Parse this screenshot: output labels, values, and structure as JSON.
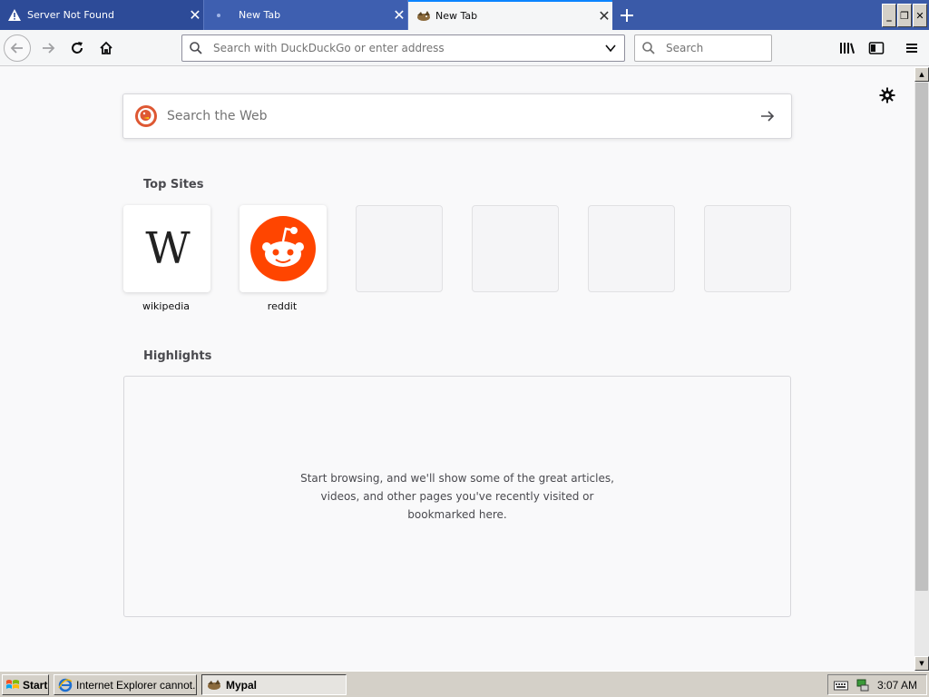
{
  "tabs": [
    {
      "title": "Server Not Found",
      "icon": "warning-icon"
    },
    {
      "title": "New Tab",
      "icon": "loading-dot-icon"
    },
    {
      "title": "New Tab",
      "icon": "mypal-icon",
      "active": true
    }
  ],
  "toolbar": {
    "url_placeholder": "Search with DuckDuckGo or enter address",
    "search_placeholder": "Search"
  },
  "newtab": {
    "web_search_placeholder": "Search the Web",
    "top_sites_title": "Top Sites",
    "top_sites": [
      {
        "label": "wikipedia"
      },
      {
        "label": "reddit"
      }
    ],
    "highlights_title": "Highlights",
    "highlights_empty_message": "Start browsing, and we'll show some of the great articles, videos, and other pages you've recently visited or bookmarked here."
  },
  "taskbar": {
    "start_label": "Start",
    "tasks": [
      {
        "label": "Internet Explorer cannot..."
      },
      {
        "label": "Mypal"
      }
    ],
    "clock": "3:07 AM"
  },
  "colors": {
    "tabstrip": "#3a5aa8",
    "reddit": "#ff4500",
    "ddg": "#de5833",
    "accent": "#0a84ff"
  }
}
